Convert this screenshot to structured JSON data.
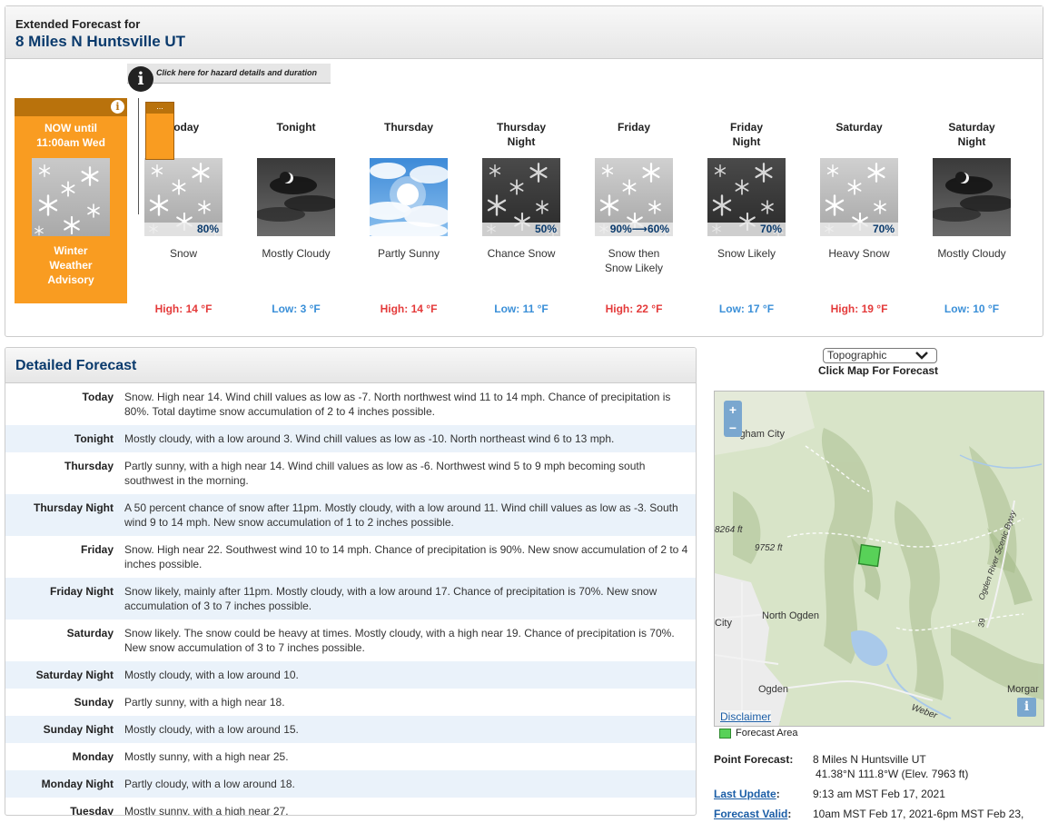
{
  "header": {
    "subtitle": "Extended Forecast for",
    "location": "8 Miles N Huntsville UT"
  },
  "hazard": {
    "link_text": "Click here for hazard details and duration"
  },
  "advisory": {
    "now_line1": "NOW until",
    "now_line2": "11:00am Wed",
    "name_line1": "Winter",
    "name_line2": "Weather",
    "name_line3": "Advisory",
    "tab_text": "..."
  },
  "periods": [
    {
      "name1": "Today",
      "name2": "",
      "icon": "snow",
      "pct": "80%",
      "desc1": "Snow",
      "desc2": "",
      "temp": "High: 14 °F",
      "kind": "hi"
    },
    {
      "name1": "Tonight",
      "name2": "",
      "icon": "night-cloudy",
      "pct": "",
      "desc1": "Mostly Cloudy",
      "desc2": "",
      "temp": "Low: 3 °F",
      "kind": "lo"
    },
    {
      "name1": "Thursday",
      "name2": "",
      "icon": "partly-sunny",
      "pct": "",
      "desc1": "Partly Sunny",
      "desc2": "",
      "temp": "High: 14 °F",
      "kind": "hi"
    },
    {
      "name1": "Thursday",
      "name2": "Night",
      "icon": "night-snow",
      "pct": "50%",
      "desc1": "Chance Snow",
      "desc2": "",
      "temp": "Low: 11 °F",
      "kind": "lo"
    },
    {
      "name1": "Friday",
      "name2": "",
      "icon": "snow",
      "pct": "90%⟶60%",
      "desc1": "Snow then",
      "desc2": "Snow Likely",
      "temp": "High: 22 °F",
      "kind": "hi"
    },
    {
      "name1": "Friday",
      "name2": "Night",
      "icon": "night-snow",
      "pct": "70%",
      "desc1": "Snow Likely",
      "desc2": "",
      "temp": "Low: 17 °F",
      "kind": "lo"
    },
    {
      "name1": "Saturday",
      "name2": "",
      "icon": "snow",
      "pct": "70%",
      "desc1": "Heavy Snow",
      "desc2": "",
      "temp": "High: 19 °F",
      "kind": "hi"
    },
    {
      "name1": "Saturday",
      "name2": "Night",
      "icon": "night-cloudy",
      "pct": "",
      "desc1": "Mostly Cloudy",
      "desc2": "",
      "temp": "Low: 10 °F",
      "kind": "lo"
    }
  ],
  "detailed": {
    "title": "Detailed Forecast",
    "rows": [
      {
        "label": "Today",
        "text": "Snow. High near 14. Wind chill values as low as -7. North northwest wind 11 to 14 mph. Chance of precipitation is 80%. Total daytime snow accumulation of 2 to 4 inches possible."
      },
      {
        "label": "Tonight",
        "text": "Mostly cloudy, with a low around 3. Wind chill values as low as -10. North northeast wind 6 to 13 mph."
      },
      {
        "label": "Thursday",
        "text": "Partly sunny, with a high near 14. Wind chill values as low as -6. Northwest wind 5 to 9 mph becoming south southwest in the morning."
      },
      {
        "label": "Thursday Night",
        "text": "A 50 percent chance of snow after 11pm. Mostly cloudy, with a low around 11. Wind chill values as low as -3. South wind 9 to 14 mph. New snow accumulation of 1 to 2 inches possible."
      },
      {
        "label": "Friday",
        "text": "Snow. High near 22. Southwest wind 10 to 14 mph. Chance of precipitation is 90%. New snow accumulation of 2 to 4 inches possible."
      },
      {
        "label": "Friday Night",
        "text": "Snow likely, mainly after 11pm. Mostly cloudy, with a low around 17. Chance of precipitation is 70%. New snow accumulation of 3 to 7 inches possible."
      },
      {
        "label": "Saturday",
        "text": "Snow likely. The snow could be heavy at times. Mostly cloudy, with a high near 19. Chance of precipitation is 70%. New snow accumulation of 3 to 7 inches possible."
      },
      {
        "label": "Saturday Night",
        "text": "Mostly cloudy, with a low around 10."
      },
      {
        "label": "Sunday",
        "text": "Partly sunny, with a high near 18."
      },
      {
        "label": "Sunday Night",
        "text": "Mostly cloudy, with a low around 15."
      },
      {
        "label": "Monday",
        "text": "Mostly sunny, with a high near 25."
      },
      {
        "label": "Monday Night",
        "text": "Partly cloudy, with a low around 18."
      },
      {
        "label": "Tuesday",
        "text": "Mostly sunny, with a high near 27."
      }
    ]
  },
  "map": {
    "select_value": "Topographic",
    "caption": "Click Map For Forecast",
    "labels": {
      "brigham": "Brigham City",
      "elev1": "8264 ft",
      "elev2": "9752 ft",
      "north_ogden": "North Ogden",
      "city": "City",
      "ogden": "Ogden",
      "morgan": "Morgar",
      "weber": "Weber",
      "byway": "Ogden River Scenic Bywy",
      "route": "39"
    },
    "zoom_in": "+",
    "zoom_out": "−",
    "disclaimer": "Disclaimer",
    "legend": "Forecast Area",
    "colors": {
      "forecast_area": "#58d158"
    }
  },
  "point": {
    "pf_label": "Point Forecast:",
    "pf_value": "8 Miles N Huntsville UT",
    "coords": "41.38°N 111.8°W (Elev. 7963 ft)",
    "lu_label": "Last Update",
    "lu_colon": ":",
    "lu_value": "9:13 am MST Feb 17, 2021",
    "fv_label": "Forecast Valid",
    "fv_colon": ":",
    "fv_value": "10am MST Feb 17, 2021-6pm MST Feb 23,"
  }
}
